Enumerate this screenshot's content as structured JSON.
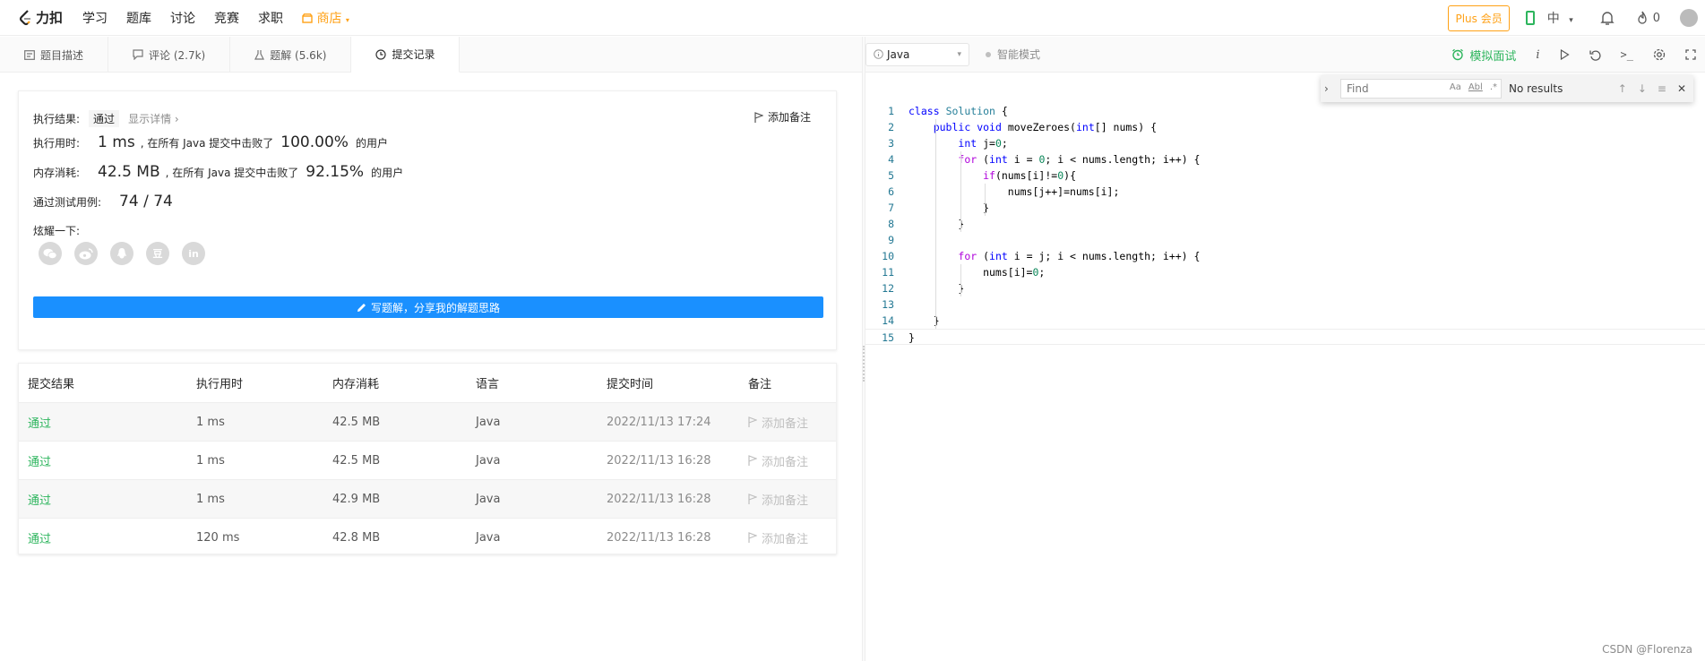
{
  "topnav": {
    "logo": "力扣",
    "links": [
      "学习",
      "题库",
      "讨论",
      "竞赛",
      "求职"
    ],
    "store": "商店",
    "plus": "Plus 会员",
    "lang": "中",
    "fire_count": "0"
  },
  "tabs": [
    {
      "label": "题目描述",
      "icon": "description-icon"
    },
    {
      "label": "评论 (2.7k)",
      "icon": "comment-icon"
    },
    {
      "label": "题解 (5.6k)",
      "icon": "flask-icon"
    },
    {
      "label": "提交记录",
      "icon": "clock-icon"
    }
  ],
  "result": {
    "status_label": "执行结果:",
    "status": "通过",
    "detail": "显示详情",
    "add_note": "添加备注",
    "runtime_label": "执行用时:",
    "runtime": "1 ms",
    "runtime_mid": ", 在所有 Java 提交中击败了",
    "runtime_pct": "100.00%",
    "users": "的用户",
    "memory_label": "内存消耗:",
    "memory": "42.5 MB",
    "memory_mid": ", 在所有 Java 提交中击败了",
    "memory_pct": "92.15%",
    "tests_label": "通过测试用例:",
    "tests": "74 / 74",
    "share_label": "炫耀一下:",
    "shares": [
      "wechat-icon",
      "weibo-icon",
      "qq-icon",
      "douban-icon",
      "linkedin-icon"
    ],
    "douban_glyph": "豆",
    "linkedin_glyph": "in",
    "write_button": "写题解，分享我的解题思路"
  },
  "table": {
    "headers": [
      "提交结果",
      "执行用时",
      "内存消耗",
      "语言",
      "提交时间",
      "备注"
    ],
    "rows": [
      [
        "通过",
        "1 ms",
        "42.5 MB",
        "Java",
        "2022/11/13 17:24",
        "添加备注"
      ],
      [
        "通过",
        "1 ms",
        "42.5 MB",
        "Java",
        "2022/11/13 16:28",
        "添加备注"
      ],
      [
        "通过",
        "1 ms",
        "42.9 MB",
        "Java",
        "2022/11/13 16:28",
        "添加备注"
      ],
      [
        "通过",
        "120 ms",
        "42.8 MB",
        "Java",
        "2022/11/13 16:28",
        "添加备注"
      ]
    ]
  },
  "editor": {
    "language": "Java",
    "smart_mode": "智能模式",
    "mock_interview": "模拟面试",
    "info_glyph": "i",
    "console_glyph": ">_",
    "find_placeholder": "Find",
    "find_case": "Aa",
    "find_word": "Abl",
    "find_regex": ".*",
    "find_result": "No results",
    "lines": [
      "class Solution {",
      "    public void moveZeroes(int[] nums) {",
      "        int j=0;",
      "        for (int i = 0; i < nums.length; i++) {",
      "            if(nums[i]!=0){",
      "                nums[j++]=nums[i];",
      "            }",
      "        }",
      "",
      "        for (int i = j; i < nums.length; i++) {",
      "            nums[i]=0;",
      "        }",
      "",
      "    }",
      "}"
    ]
  },
  "watermark": "CSDN @Florenza",
  "colors": {
    "accent": "#ffa116",
    "green": "#2db55d",
    "blue": "#1a90ff"
  }
}
